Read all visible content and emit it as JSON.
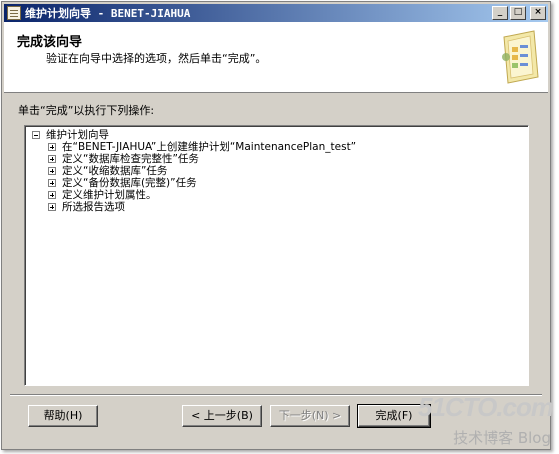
{
  "window": {
    "title": "维护计划向导 - BENET-JIAHUA",
    "caption_buttons": {
      "minimize": "_",
      "maximize": "□",
      "close": "×"
    }
  },
  "header": {
    "title": "完成该向导",
    "subtitle": "验证在向导中选择的选项，然后单击“完成”。"
  },
  "instruction": "单击“完成”以执行下列操作:",
  "tree": {
    "root": "维护计划向导",
    "items": [
      "在“BENET-JIAHUA”上创建维护计划“MaintenancePlan_test”",
      "定义“数据库检查完整性”任务",
      "定义“收缩数据库”任务",
      "定义“备份数据库(完整)”任务",
      "定义维护计划属性。",
      "所选报告选项"
    ]
  },
  "buttons": {
    "help": "帮助(H)",
    "back": "< 上一步(B)",
    "next": "下一步(N) >",
    "finish": "完成(F)"
  },
  "watermark": {
    "site": "51CTO.com",
    "tagline": "技术博客 Blog"
  },
  "icons": [
    "app-icon",
    "wizard-graphic-icon",
    "collapse-icon",
    "expand-icon"
  ]
}
